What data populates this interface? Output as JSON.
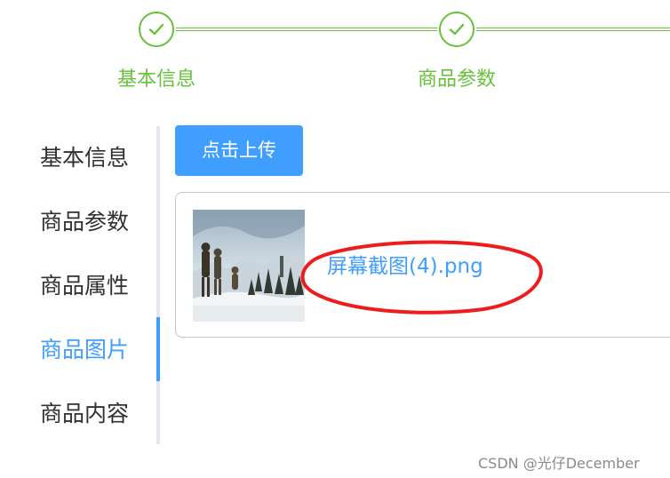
{
  "steps": [
    {
      "title": "基本信息",
      "icon": "check-icon",
      "status": "finish"
    },
    {
      "title": "商品参数",
      "icon": "check-icon",
      "status": "finish"
    }
  ],
  "tabs": {
    "items": [
      "基本信息",
      "商品参数",
      "商品属性",
      "商品图片",
      "商品内容"
    ],
    "active_index": 3
  },
  "upload": {
    "button_label": "点击上传",
    "file_name": "屏幕截图(4).png",
    "thumbnail_icon": "image-thumbnail"
  },
  "annotation": {
    "shape": "ellipse",
    "color": "#ee1c1c"
  },
  "watermark": "CSDN @光仔December",
  "colors": {
    "success": "#67c23a",
    "primary": "#409eff",
    "text": "#303133",
    "rail": "#e4e7ed"
  }
}
